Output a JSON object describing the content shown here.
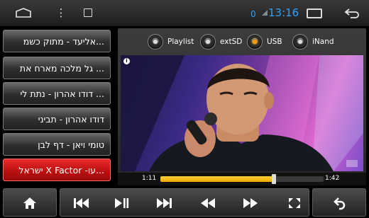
{
  "status_bar": {
    "notification_count": "0",
    "time": "13:16",
    "icons": [
      "home-outline-icon",
      "menu-dots-icon",
      "image-icon",
      "signal-icon",
      "recent-apps-icon",
      "back-arrow-icon"
    ]
  },
  "playlist": {
    "items": [
      {
        "label": "אליעד - מתוק כשמ..."
      },
      {
        "label": "גל מלכה מארח את ..."
      },
      {
        "label": "דודו אהרון - נתת לי ..."
      },
      {
        "label": "דודו אהרון - תביני"
      },
      {
        "label": "טומי ויאן - דף לבן"
      },
      {
        "label": "ישראל X Factor -עו...",
        "active": true
      }
    ]
  },
  "sources": [
    {
      "label": "Playlist",
      "selected": false
    },
    {
      "label": "extSD",
      "selected": false
    },
    {
      "label": "USB",
      "selected": true
    },
    {
      "label": "iNand",
      "selected": false
    }
  ],
  "player": {
    "elapsed": "1:11",
    "duration": "1:42",
    "progress_fraction": 0.696
  },
  "controls": {
    "icons": [
      "home-icon",
      "previous-icon",
      "play-pause-icon",
      "next-icon",
      "rewind-icon",
      "fast-forward-icon",
      "fullscreen-icon",
      "back-icon"
    ]
  },
  "colors": {
    "accent_blue": "#2aa3ff",
    "active_item_red": "#c81414",
    "progress_yellow": "#f7c21c",
    "selected_source_orange": "#ff9a00"
  }
}
